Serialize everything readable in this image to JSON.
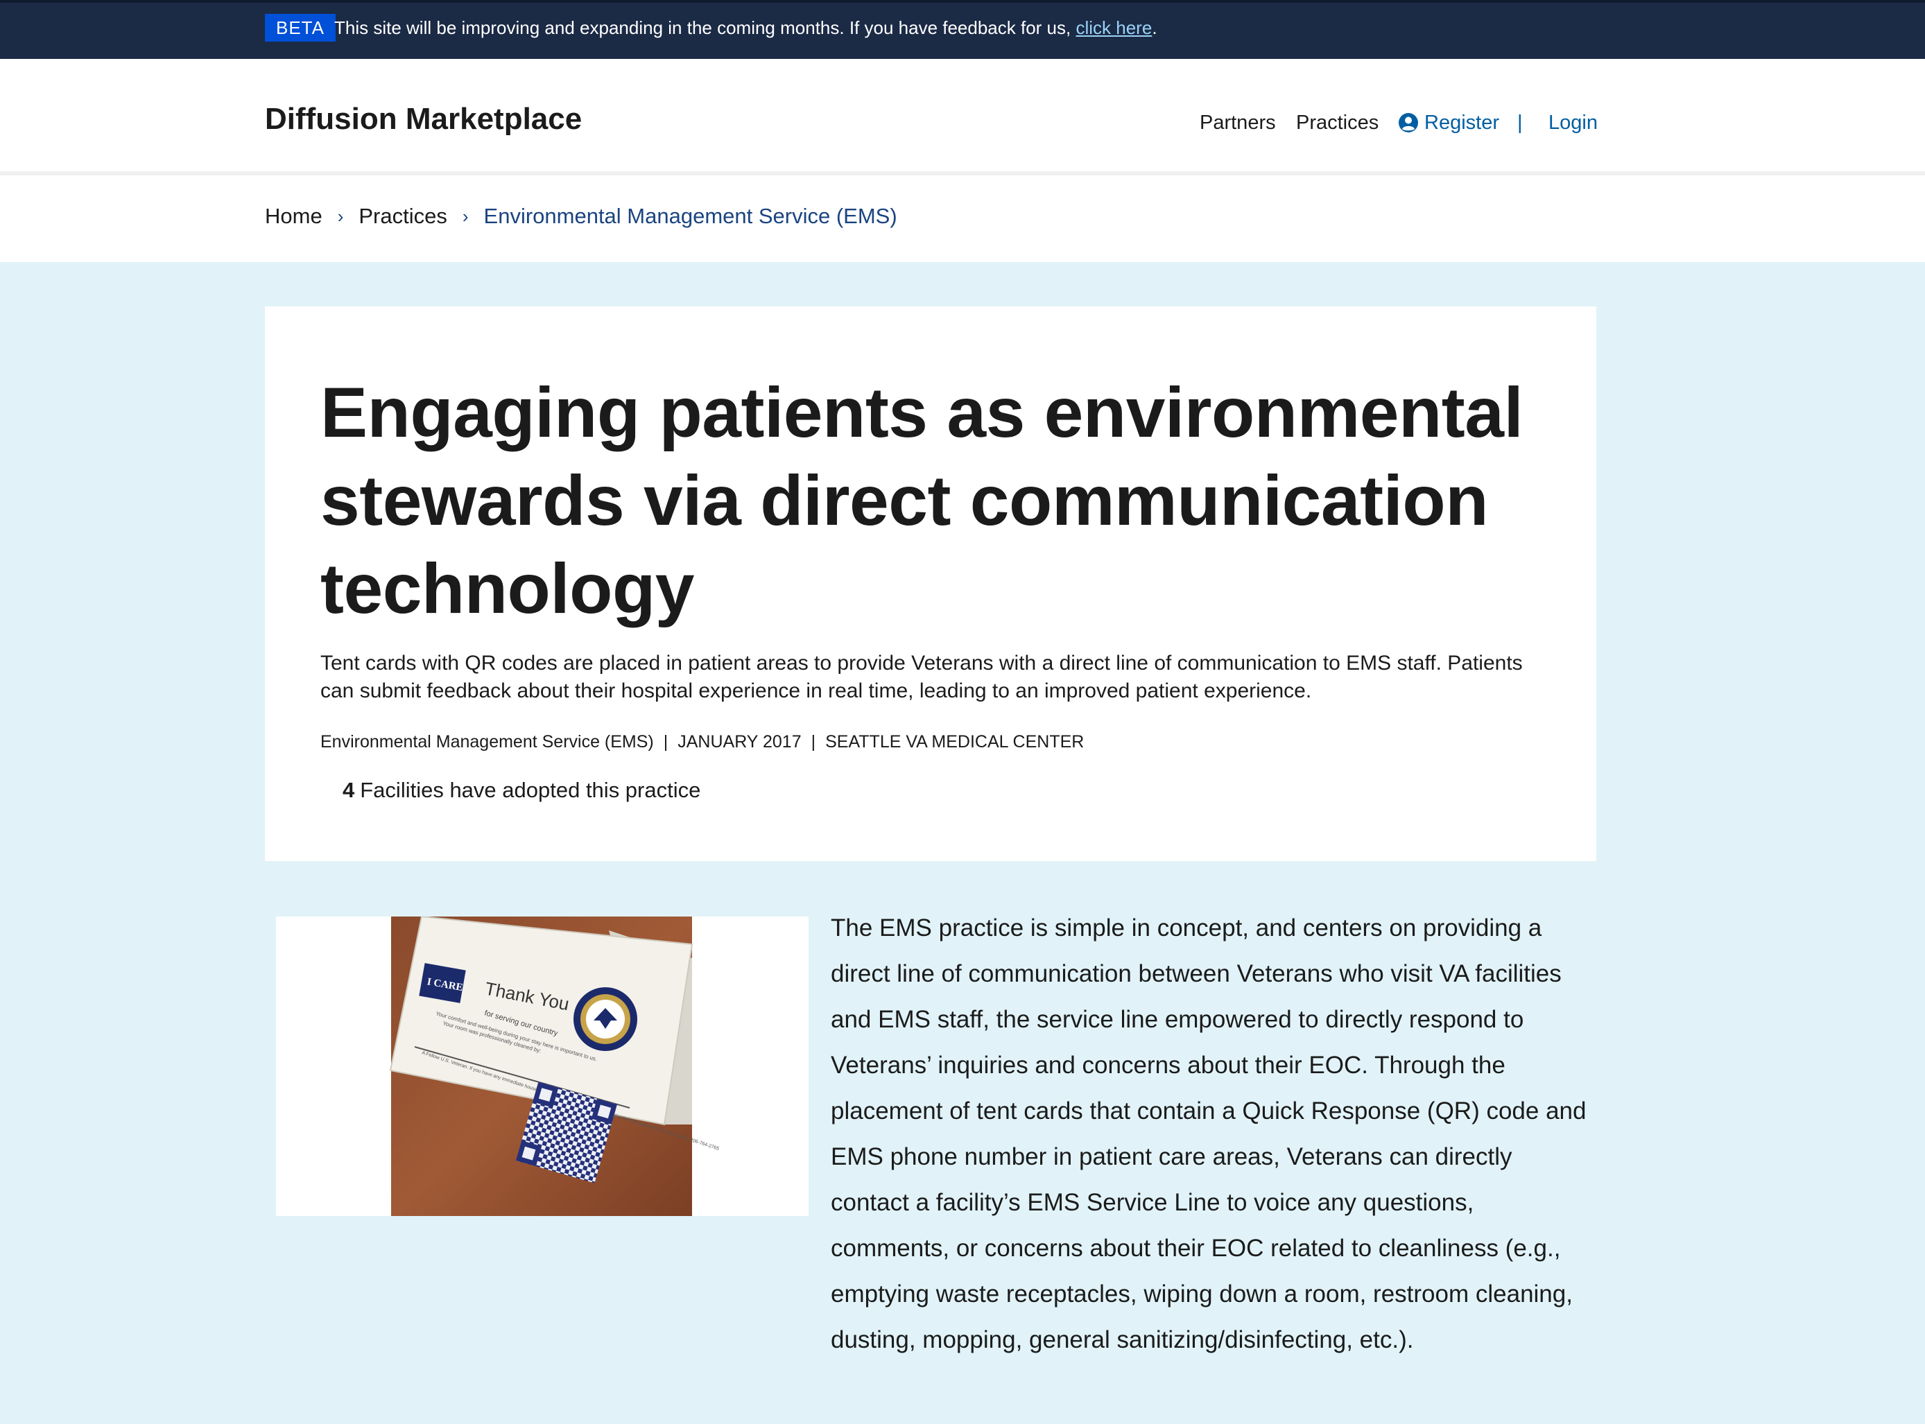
{
  "banner": {
    "tag": "BETA",
    "message": "This site will be improving and expanding in the coming months. If you have feedback for us,",
    "link_text": "click here",
    "trailing": "."
  },
  "header": {
    "brand": "Diffusion Marketplace",
    "nav": {
      "partners": "Partners",
      "practices": "Practices",
      "register": "Register",
      "separator": "|",
      "login": "Login"
    }
  },
  "breadcrumb": {
    "items": [
      "Home",
      "Practices",
      "Environmental Management Service (EMS)"
    ],
    "separator": "›"
  },
  "practice": {
    "title": "Engaging patients as environmental stewards via direct communication technology",
    "summary": "Tent cards with QR codes are placed in patient areas to provide Veterans with a direct line of communication to EMS staff. Patients can submit feedback about their hospital experience in real time, leading to an improved patient experience.",
    "meta": {
      "department": "Environmental Management Service (EMS)",
      "date": "JANUARY 2017",
      "facility": "SEATTLE VA MEDICAL CENTER",
      "separator": "|"
    },
    "adoption": {
      "count": "4",
      "label": "Facilities have adopted this practice"
    },
    "image_card": {
      "badge": "I CARE",
      "heading": "Thank You",
      "line1": "for serving our country",
      "line2": "Your comfort and well-being during your stay here is important to us.",
      "line3": "Your room was professionally cleaned by:",
      "small_text": "A Fellow U.S. Veteran. If you have any immediate housekeeping needs please call the Environmental Management Service Line at 206-764-2765"
    },
    "description": "The EMS practice is simple in concept, and centers on providing a direct line of communication between Veterans who visit VA facilities and EMS staff, the service line empowered to directly respond to Veterans’ inquiries and concerns about their EOC. Through the placement of tent cards that contain a Quick Response (QR) code and EMS phone number in patient care areas, Veterans can directly contact a facility’s EMS Service Line to voice any questions, comments, or concerns about their EOC related to cleanliness (e.g., emptying waste receptacles, wiping down a room, restroom cleaning, dusting, mopping, general sanitizing/disinfecting, etc.)."
  },
  "colors": {
    "banner_bg": "#1b2a45",
    "beta_tag": "#0050d8",
    "link": "#005ea2",
    "page_bg": "#e1f3f8",
    "breadcrumb_current": "#1a4480"
  }
}
